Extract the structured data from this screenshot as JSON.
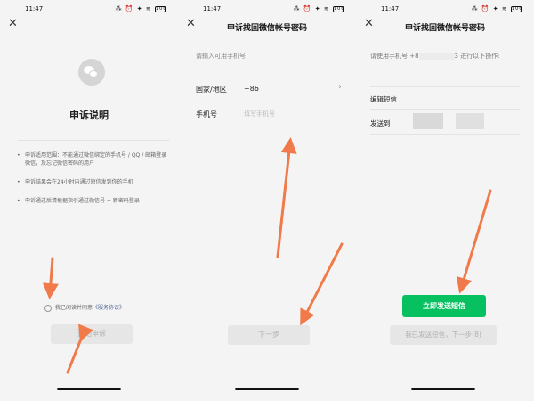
{
  "status": {
    "time": "11:47",
    "icons": "⁂ ⏰ ✦ ≋",
    "battery": "100"
  },
  "screen1": {
    "heading": "申诉说明",
    "notes": [
      "申诉适用范围：不能通过微信绑定的手机号 / QQ / 邮箱登录微信，及忘记微信密码的用户",
      "申诉结果会在24小时内通过短信发到你的手机",
      "申诉通过后请根据指引通过微信号 + 新密码登录"
    ],
    "agree_text": "我已阅读并同意",
    "agree_link": "《服务协议》",
    "start_button": "开始申诉"
  },
  "screen2": {
    "title": "申诉找回微信帐号密码",
    "hint": "请输入可用手机号",
    "country_label": "国家/地区",
    "country_value": "+86",
    "phone_label": "手机号",
    "phone_placeholder": "填写手机号",
    "next_button": "下一步"
  },
  "screen3": {
    "title": "申诉找回微信帐号密码",
    "instruction_prefix": "请使用手机号 +8",
    "instruction_suffix": "3 进行以下操作:",
    "edit_sms_label": "编辑短信",
    "send_to_label": "发送到",
    "send_button": "立即发送短信",
    "sent_button": "我已发送短信，下一步(8)"
  },
  "colors": {
    "green": "#07c160",
    "arrow": "#f07a4a",
    "link": "#566b94"
  }
}
